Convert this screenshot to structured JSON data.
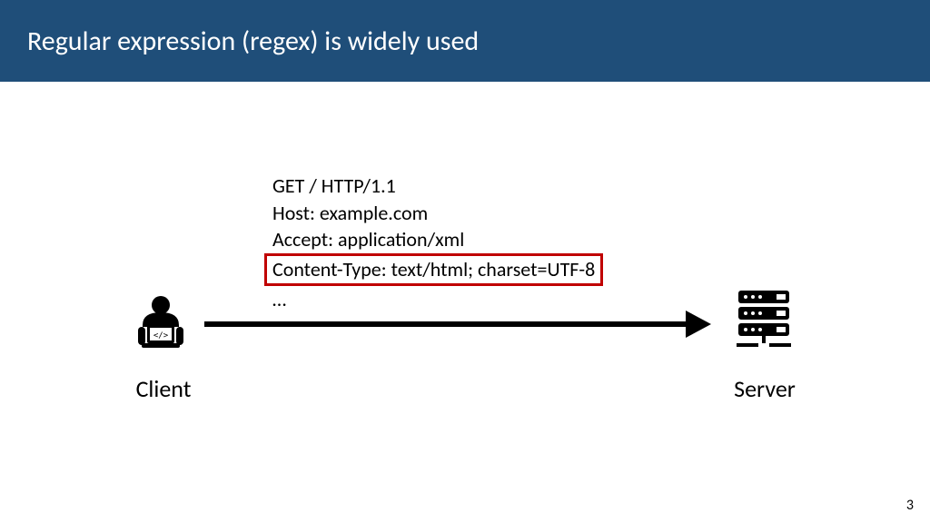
{
  "header": {
    "title": "Regular expression (regex) is widely used"
  },
  "http": {
    "line1": "GET / HTTP/1.1",
    "line2": "Host: example.com",
    "line3": "Accept: application/xml",
    "line4": "Content-Type: text/html; charset=UTF-8",
    "line5": "…"
  },
  "labels": {
    "client": "Client",
    "server": "Server"
  },
  "page_number": "3",
  "colors": {
    "header_bg": "#1f4e79",
    "highlight_border": "#c00000"
  }
}
